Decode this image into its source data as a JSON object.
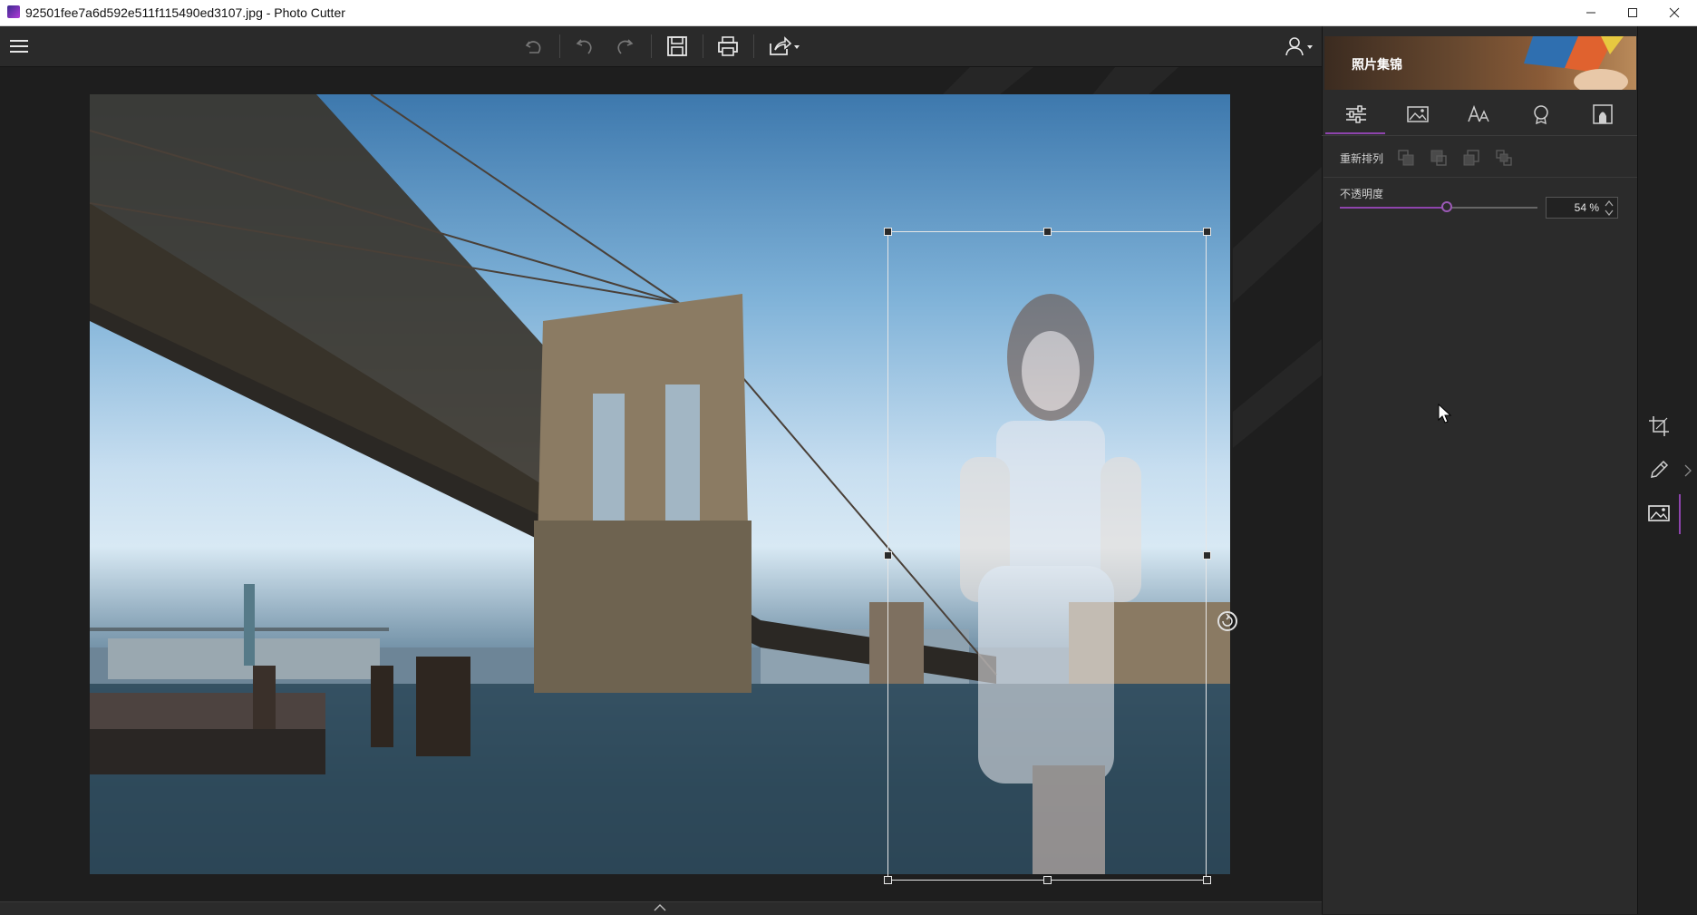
{
  "window": {
    "title": "92501fee7a6d592e511f115490ed3107.jpg - Photo Cutter"
  },
  "panel": {
    "banner_text": "照片集锦",
    "arrange_label": "重新排列",
    "opacity_label": "不透明度",
    "opacity_value": "54 %",
    "opacity_level": 0.54,
    "tabs": [
      "adjust-tab",
      "background-tab",
      "text-tab",
      "sticker-tab",
      "portrait-tab"
    ]
  },
  "toolbar": {
    "icons": [
      "menu-icon",
      "undo-icon",
      "undo-step-icon",
      "redo-icon",
      "save-icon",
      "print-icon",
      "share-icon",
      "user-icon"
    ]
  },
  "strip": {
    "icons": [
      "crop-icon",
      "edit-icon",
      "image-layer-icon"
    ]
  },
  "colors": {
    "accent": "#8e44ad",
    "panel_bg": "#2b2b2b",
    "toolbar_bg": "#2a2a2a"
  }
}
